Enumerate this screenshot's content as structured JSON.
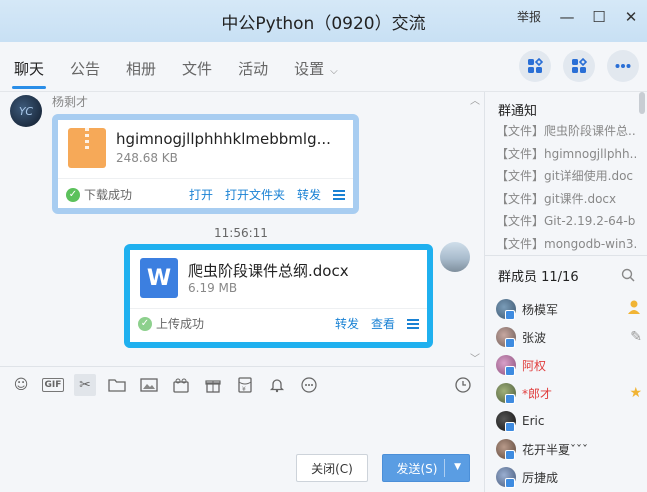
{
  "window": {
    "title": "中公Python（0920）交流",
    "report": "举报",
    "minimize": "—",
    "maximize": "☐",
    "close": "✕"
  },
  "tabs": [
    {
      "label": "聊天",
      "active": true
    },
    {
      "label": "公告"
    },
    {
      "label": "相册"
    },
    {
      "label": "文件"
    },
    {
      "label": "活动"
    },
    {
      "label": "设置"
    }
  ],
  "chat": {
    "msg1": {
      "sender": "杨剩才",
      "file_name": "hgimnogjllphhhklmebbmlg...",
      "file_size": "248.68 KB",
      "status": "下载成功",
      "actions": [
        "打开",
        "打开文件夹",
        "转发"
      ]
    },
    "timestamp": "11:56:11",
    "msg2": {
      "file_name": "爬虫阶段课件总纲.docx",
      "file_size": "6.19 MB",
      "status": "上传成功",
      "actions": [
        "转发",
        "查看"
      ]
    }
  },
  "toolbar": {
    "gif": "GIF",
    "icons": [
      "emoji-icon",
      "gif-icon",
      "scissors-icon",
      "folder-icon",
      "image-icon",
      "gift-box-icon",
      "gift-icon",
      "red-packet-icon",
      "bell-icon",
      "more-icon",
      "history-clock-icon"
    ]
  },
  "buttons": {
    "close": "关闭(C)",
    "send": "发送(S)"
  },
  "notices": {
    "title": "群通知",
    "items": [
      "【文件】爬虫阶段课件总...",
      "【文件】hgimnogjllphh...",
      "【文件】git详细使用.doc",
      "【文件】git课件.docx",
      "【文件】Git-2.19.2-64-b...",
      "【文件】mongodb-win3..."
    ]
  },
  "members": {
    "title": "群成员 11/16",
    "list": [
      {
        "name": "杨模军",
        "badge": "owner"
      },
      {
        "name": "张波",
        "badge": "edit"
      },
      {
        "name": "阿权",
        "red": true
      },
      {
        "name": "*郎才",
        "red": true,
        "badge": "star"
      },
      {
        "name": "Eric"
      },
      {
        "name": "花开半夏ˇˇˇ"
      },
      {
        "name": "厉捷成"
      }
    ]
  },
  "colors": {
    "accent": "#2a8ee8",
    "bubble_in_border": "#a8cdf1",
    "bubble_out_border": "#1fb0ef",
    "link": "#1a82d4",
    "success": "#5cc15c",
    "send_button": "#5a9de3"
  }
}
